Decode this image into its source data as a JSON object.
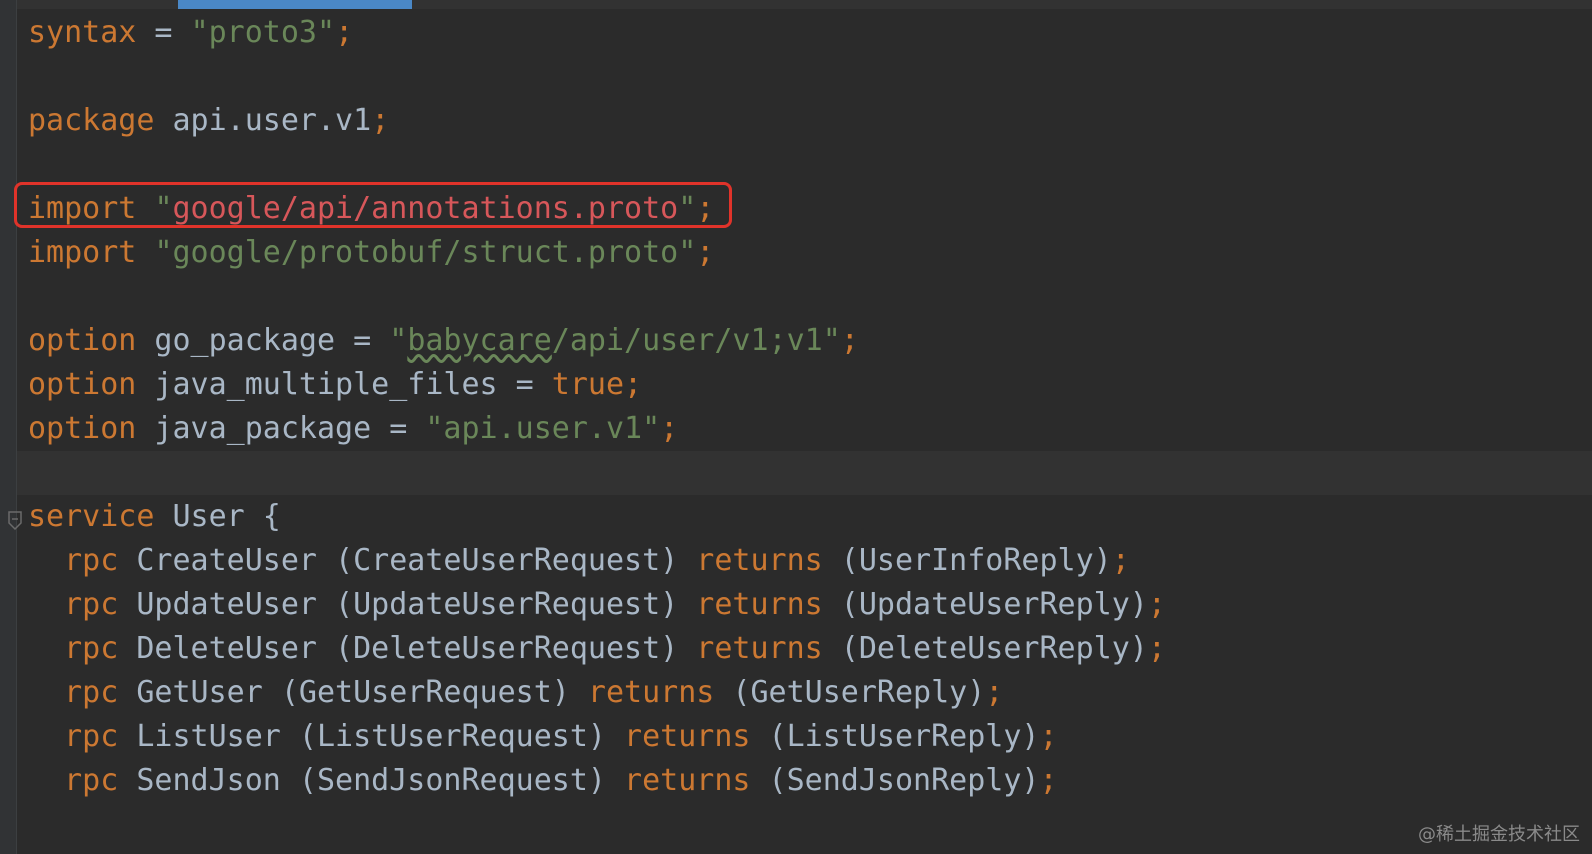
{
  "editor": {
    "lines": [
      {
        "segments": [
          {
            "t": "syntax",
            "c": "kw"
          },
          {
            "t": " = ",
            "c": "plain"
          },
          {
            "t": "\"proto3\"",
            "c": "str"
          },
          {
            "t": ";",
            "c": "kw"
          }
        ]
      },
      {
        "segments": []
      },
      {
        "segments": [
          {
            "t": "package",
            "c": "kw"
          },
          {
            "t": " api.user.v1",
            "c": "plain"
          },
          {
            "t": ";",
            "c": "kw"
          }
        ]
      },
      {
        "segments": []
      },
      {
        "segments": [
          {
            "t": "import",
            "c": "kw"
          },
          {
            "t": " ",
            "c": "plain"
          },
          {
            "t": "\"",
            "c": "str"
          },
          {
            "t": "google/api/annotations.proto",
            "c": "str-err"
          },
          {
            "t": "\"",
            "c": "str"
          },
          {
            "t": ";",
            "c": "kw"
          }
        ]
      },
      {
        "segments": [
          {
            "t": "import",
            "c": "kw"
          },
          {
            "t": " ",
            "c": "plain"
          },
          {
            "t": "\"google/protobuf/struct.proto\"",
            "c": "str"
          },
          {
            "t": ";",
            "c": "kw"
          }
        ]
      },
      {
        "segments": []
      },
      {
        "segments": [
          {
            "t": "option",
            "c": "kw"
          },
          {
            "t": " go_package = ",
            "c": "plain"
          },
          {
            "t": "\"",
            "c": "str"
          },
          {
            "t": "babycare",
            "c": "str typo"
          },
          {
            "t": "/api/user/v1;v1\"",
            "c": "str"
          },
          {
            "t": ";",
            "c": "kw"
          }
        ]
      },
      {
        "segments": [
          {
            "t": "option",
            "c": "kw"
          },
          {
            "t": " java_multiple_files = ",
            "c": "plain"
          },
          {
            "t": "true",
            "c": "kw"
          },
          {
            "t": ";",
            "c": "kw"
          }
        ]
      },
      {
        "segments": [
          {
            "t": "option",
            "c": "kw"
          },
          {
            "t": " java_package = ",
            "c": "plain"
          },
          {
            "t": "\"api.user.v1\"",
            "c": "str"
          },
          {
            "t": ";",
            "c": "kw"
          }
        ]
      },
      {
        "segments": []
      },
      {
        "segments": [
          {
            "t": "service",
            "c": "kw"
          },
          {
            "t": " User {",
            "c": "plain"
          }
        ]
      },
      {
        "segments": [
          {
            "t": "  ",
            "c": "plain"
          },
          {
            "t": "rpc",
            "c": "kw"
          },
          {
            "t": " CreateUser (CreateUserRequest) ",
            "c": "plain"
          },
          {
            "t": "returns",
            "c": "kw"
          },
          {
            "t": " (UserInfoReply)",
            "c": "plain"
          },
          {
            "t": ";",
            "c": "kw"
          }
        ]
      },
      {
        "segments": [
          {
            "t": "  ",
            "c": "plain"
          },
          {
            "t": "rpc",
            "c": "kw"
          },
          {
            "t": " UpdateUser (UpdateUserRequest) ",
            "c": "plain"
          },
          {
            "t": "returns",
            "c": "kw"
          },
          {
            "t": " (UpdateUserReply)",
            "c": "plain"
          },
          {
            "t": ";",
            "c": "kw"
          }
        ]
      },
      {
        "segments": [
          {
            "t": "  ",
            "c": "plain"
          },
          {
            "t": "rpc",
            "c": "kw"
          },
          {
            "t": " DeleteUser (DeleteUserRequest) ",
            "c": "plain"
          },
          {
            "t": "returns",
            "c": "kw"
          },
          {
            "t": " (DeleteUserReply)",
            "c": "plain"
          },
          {
            "t": ";",
            "c": "kw"
          }
        ]
      },
      {
        "segments": [
          {
            "t": "  ",
            "c": "plain"
          },
          {
            "t": "rpc",
            "c": "kw"
          },
          {
            "t": " GetUser (GetUserRequest) ",
            "c": "plain"
          },
          {
            "t": "returns",
            "c": "kw"
          },
          {
            "t": " (GetUserReply)",
            "c": "plain"
          },
          {
            "t": ";",
            "c": "kw"
          }
        ]
      },
      {
        "segments": [
          {
            "t": "  ",
            "c": "plain"
          },
          {
            "t": "rpc",
            "c": "kw"
          },
          {
            "t": " ListUser (ListUserRequest) ",
            "c": "plain"
          },
          {
            "t": "returns",
            "c": "kw"
          },
          {
            "t": " (ListUserReply)",
            "c": "plain"
          },
          {
            "t": ";",
            "c": "kw"
          }
        ]
      },
      {
        "segments": [
          {
            "t": "  ",
            "c": "plain"
          },
          {
            "t": "rpc",
            "c": "kw"
          },
          {
            "t": " SendJson (SendJsonRequest) ",
            "c": "plain"
          },
          {
            "t": "returns",
            "c": "kw"
          },
          {
            "t": " (SendJsonReply)",
            "c": "plain"
          },
          {
            "t": ";",
            "c": "kw"
          }
        ]
      }
    ]
  },
  "colors": {
    "background": "#2b2b2b",
    "keyword": "#cc7832",
    "string": "#6a8759",
    "identifier": "#a9b7c6",
    "error_string": "#d7575a",
    "annotation_box": "#e0332a",
    "tab_indicator": "#4a88c7"
  },
  "icons": {
    "fold": "fold-marker-icon"
  },
  "watermark": "@稀土掘金技术社区"
}
